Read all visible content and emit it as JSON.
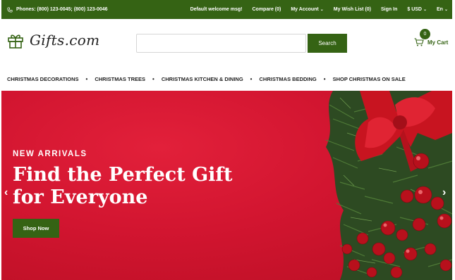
{
  "topbar": {
    "phones": "Phones: (800) 123-0045; (800) 123-0046",
    "welcome": "Default welcome msg!",
    "compare": "Compare (0)",
    "account": "My Account",
    "wishlist": "My Wish List (0)",
    "signin": "Sign In",
    "currency": "$ USD",
    "language": "En",
    "caret": "⌄"
  },
  "header": {
    "logo_text": "Gifts.com",
    "search_placeholder": "",
    "search_button": "Search",
    "cart_count": "0",
    "cart_label": "My Cart"
  },
  "nav": {
    "items": [
      "CHRISTMAS DECORATIONS",
      "CHRISTMAS TREES",
      "CHRISTMAS KITCHEN & DINING",
      "CHRISTMAS BEDDING",
      "SHOP CHRISTMAS ON SALE"
    ],
    "separator": "•"
  },
  "hero": {
    "subtitle": "NEW ARRIVALS",
    "title": "Find the Perfect Gift for Everyone",
    "button": "Shop Now",
    "prev": "‹",
    "next": "›"
  },
  "colors": {
    "brand_green": "#356314",
    "hero_red": "#d21530"
  },
  "icons": [
    "phone-icon",
    "gift-icon",
    "cart-icon",
    "chevron-left-icon",
    "chevron-right-icon"
  ]
}
